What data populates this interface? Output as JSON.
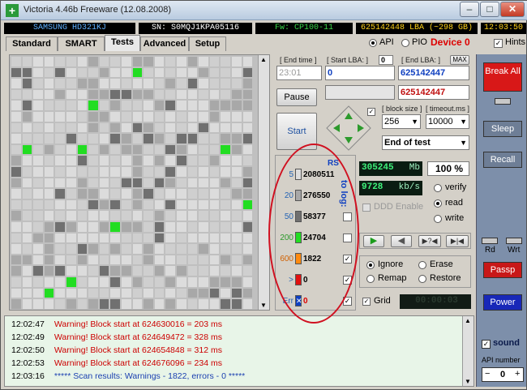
{
  "window": {
    "title": "Victoria 4.46b Freeware (12.08.2008)"
  },
  "infobar": {
    "model": "SAMSUNG HD321KJ",
    "serial": "SN: S0MQJ1KPA05116",
    "firmware": "Fw: CP100-11",
    "capacity": "625142448 LBA (~298 GB)",
    "clock": "12:03:50"
  },
  "tabs": [
    "Standard",
    "SMART",
    "Tests",
    "Advanced",
    "Setup"
  ],
  "mode": {
    "api": "API",
    "pio": "PIO",
    "device": "Device 0",
    "hints": "Hints"
  },
  "controls": {
    "end_time_label": "[ End time ]",
    "end_time_value": "23:01",
    "start_lba_label": "[ Start LBA: ]",
    "start_lba_small": "0",
    "start_lba_value": "0",
    "end_lba_label": "[ End LBA: ]",
    "end_lba_max": "MAX",
    "end_lba_value": "625142447",
    "end_lba_value2": "625142447",
    "pause": "Pause",
    "start": "Start",
    "block_size_label": "[ block size ]",
    "block_size_value": "256",
    "timeout_label": "[ timeout.ms ]",
    "timeout_value": "10000",
    "end_of_test": "End of test"
  },
  "legend": {
    "rows": [
      {
        "label": "5",
        "value": "2080511",
        "color": "#dcdcdc",
        "checked": ""
      },
      {
        "label": "20",
        "value": "276550",
        "color": "#a8a8a8",
        "checked": ""
      },
      {
        "label": "50",
        "value": "58377",
        "color": "#707070",
        "checked": ""
      },
      {
        "label": "200",
        "value": "24704",
        "color": "#22dd22",
        "checked": ""
      },
      {
        "label": "600",
        "value": "1822",
        "color": "#ff8a10",
        "checked": "✓"
      },
      {
        "label": ">",
        "value": "0",
        "color": "#e01010",
        "checked": "✓"
      },
      {
        "label": "Err",
        "value": "0",
        "color": "#1040c0",
        "checked": "✓"
      }
    ],
    "rs_label": "RS",
    "log_label": "to log:"
  },
  "stats": {
    "mb_value": "305245",
    "mb_unit": "Mb",
    "percent": "100",
    "percent_unit": "%",
    "speed_value": "9728",
    "speed_unit": "kb/s",
    "ddd_enable": "DDD Enable",
    "verify": "verify",
    "read": "read",
    "write": "write",
    "ignore": "Ignore",
    "erase": "Erase",
    "remap": "Remap",
    "restore": "Restore",
    "grid": "Grid",
    "timer": "00:00:03"
  },
  "side": {
    "break_all": "Break All",
    "sleep": "Sleep",
    "recall": "Recall",
    "rd": "Rd",
    "wrt": "Wrt",
    "passp": "Passp",
    "power": "Power",
    "sound": "sound",
    "api_number": "API number",
    "api_value": "0"
  },
  "log": [
    {
      "time": "12:02:47",
      "msg": "Warning! Block start at 624630016 = 203 ms",
      "color": "#cc0000"
    },
    {
      "time": "12:02:49",
      "msg": "Warning! Block start at 624649472 = 328 ms",
      "color": "#cc0000"
    },
    {
      "time": "12:02:50",
      "msg": "Warning! Block start at 624654848 = 312 ms",
      "color": "#cc0000"
    },
    {
      "time": "12:02:53",
      "msg": "Warning! Block start at 624676096 = 234 ms",
      "color": "#cc0000"
    },
    {
      "time": "12:03:16",
      "msg": "***** Scan results: Warnings - 1822, errors - 0 *****",
      "color": "#1a3fb0"
    }
  ]
}
